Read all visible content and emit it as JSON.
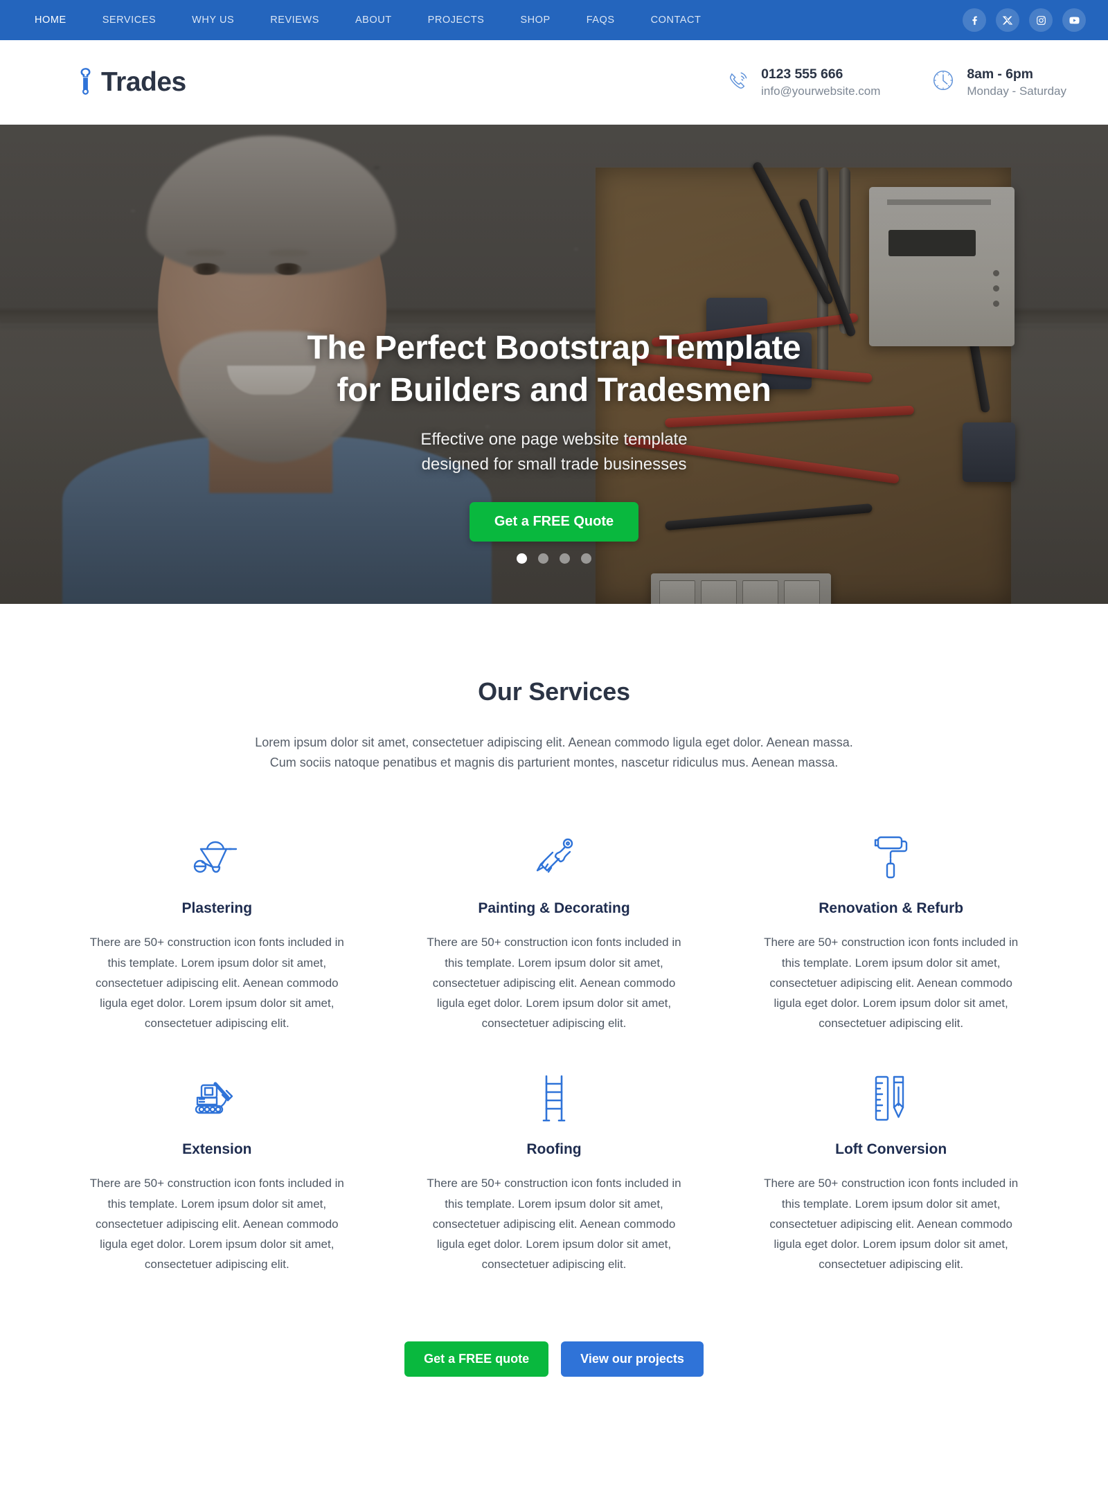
{
  "topnav": {
    "items": [
      {
        "label": "HOME",
        "active": true
      },
      {
        "label": "SERVICES",
        "active": false
      },
      {
        "label": "WHY US",
        "active": false
      },
      {
        "label": "REVIEWS",
        "active": false
      },
      {
        "label": "ABOUT",
        "active": false
      },
      {
        "label": "PROJECTS",
        "active": false
      },
      {
        "label": "SHOP",
        "active": false
      },
      {
        "label": "FAQS",
        "active": false
      },
      {
        "label": "CONTACT",
        "active": false
      }
    ],
    "social": [
      {
        "name": "facebook-icon",
        "label": "Facebook"
      },
      {
        "name": "x-icon",
        "label": "X"
      },
      {
        "name": "instagram-icon",
        "label": "Instagram"
      },
      {
        "name": "youtube-icon",
        "label": "YouTube"
      }
    ],
    "background_color": "#2465bd"
  },
  "header": {
    "logo_text": "Trades",
    "logo_icon": "wrench-icon",
    "phone_icon": "phone-ring-icon",
    "phone": "0123 555 666",
    "email": "info@yourwebsite.com",
    "clock_icon": "clock-icon",
    "hours": "8am - 6pm",
    "days": "Monday - Saturday"
  },
  "hero": {
    "title_line1": "The Perfect Bootstrap Template",
    "title_line2": "for Builders and Tradesmen",
    "subtitle_line1": "Effective one page website template",
    "subtitle_line2": "designed for small trade businesses",
    "cta_label": "Get a FREE Quote",
    "cta_color": "#09b83e",
    "slide_count": 4,
    "active_slide": 1
  },
  "services": {
    "title": "Our Services",
    "intro_line1": "Lorem ipsum dolor sit amet, consectetuer adipiscing elit. Aenean commodo ligula eget dolor. Aenean massa.",
    "intro_line2": "Cum sociis natoque penatibus et magnis dis parturient montes, nascetur ridiculus mus. Aenean massa.",
    "items": [
      {
        "name": "Plastering",
        "icon": "wheelbarrow-icon",
        "desc": "There are 50+ construction icon fonts included in this template. Lorem ipsum dolor sit amet, consectetuer adipiscing elit. Aenean commodo ligula eget dolor. Lorem ipsum dolor sit amet, consectetuer adipiscing elit."
      },
      {
        "name": "Painting & Decorating",
        "icon": "paintbrush-icon",
        "desc": "There are 50+ construction icon fonts included in this template. Lorem ipsum dolor sit amet, consectetuer adipiscing elit. Aenean commodo ligula eget dolor. Lorem ipsum dolor sit amet, consectetuer adipiscing elit."
      },
      {
        "name": "Renovation & Refurb",
        "icon": "paint-roller-icon",
        "desc": "There are 50+ construction icon fonts included in this template. Lorem ipsum dolor sit amet, consectetuer adipiscing elit. Aenean commodo ligula eget dolor. Lorem ipsum dolor sit amet, consectetuer adipiscing elit."
      },
      {
        "name": "Extension",
        "icon": "excavator-icon",
        "desc": "There are 50+ construction icon fonts included in this template. Lorem ipsum dolor sit amet, consectetuer adipiscing elit. Aenean commodo ligula eget dolor. Lorem ipsum dolor sit amet, consectetuer adipiscing elit."
      },
      {
        "name": "Roofing",
        "icon": "ladder-icon",
        "desc": "There are 50+ construction icon fonts included in this template. Lorem ipsum dolor sit amet, consectetuer adipiscing elit. Aenean commodo ligula eget dolor. Lorem ipsum dolor sit amet, consectetuer adipiscing elit."
      },
      {
        "name": "Loft Conversion",
        "icon": "ruler-pencil-icon",
        "desc": "There are 50+ construction icon fonts included in this template. Lorem ipsum dolor sit amet, consectetuer adipiscing elit. Aenean commodo ligula eget dolor. Lorem ipsum dolor sit amet, consectetuer adipiscing elit."
      }
    ],
    "icon_color": "#2f73d8",
    "cta_primary": "Get a FREE quote",
    "cta_secondary": "View our projects"
  }
}
